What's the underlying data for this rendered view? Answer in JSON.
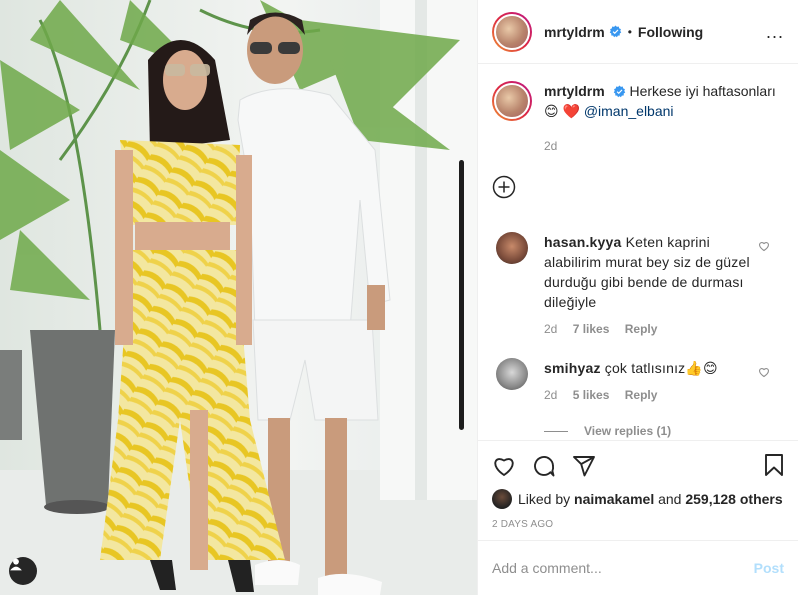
{
  "post": {
    "username": "mrtyldrm",
    "follow_label": "Following",
    "dot": "•",
    "more_label": "...",
    "caption": {
      "username": "mrtyldrm",
      "text": "Herkese iyi haftasonları",
      "emoji": "😊 ❤️",
      "mention": "@iman_elbani",
      "age": "2d"
    }
  },
  "comments": [
    {
      "username": "hasan.kyya",
      "text": "Keten kaprini alabilirim murat bey siz de güzel durduğu gibi bende de durması dileğiyle",
      "age": "2d",
      "likes": "7 likes",
      "reply": "Reply"
    },
    {
      "username": "smihyaz",
      "text": "çok tatlısınız👍😊",
      "age": "2d",
      "likes": "5 likes",
      "reply": "Reply",
      "view_replies": "View replies (1)"
    }
  ],
  "footer": {
    "liked_by_prefix": "Liked by",
    "liked_by_user": "naimakamel",
    "and_label": "and",
    "likes_count": "259,128 others",
    "timestamp": "2 DAYS AGO",
    "comment_placeholder": "Add a comment...",
    "post_label": "Post"
  },
  "colors": {
    "verified": "#3897f0",
    "link": "#00376b",
    "heart": "#ed4956",
    "post_disabled": "#b2dffc"
  },
  "icons": [
    "verified-icon",
    "add-icon",
    "heart-icon",
    "comment-icon",
    "share-icon",
    "bookmark-icon",
    "user-tag-icon"
  ]
}
